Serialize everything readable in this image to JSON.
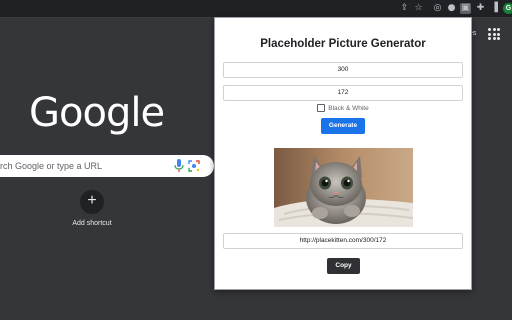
{
  "browser": {
    "icons": [
      "share-icon",
      "star-icon",
      "extension-icon",
      "extension-icon",
      "placeholder-extension-icon",
      "puzzle-icon",
      "sidebar-icon"
    ],
    "profile_initial": "G"
  },
  "ntp": {
    "logo_text": "Google",
    "search_placeholder": "rch Google or type a URL",
    "shortcut_label": "Add shortcut",
    "images_link": "ges"
  },
  "popup": {
    "title": "Placeholder Picture Generator",
    "width_value": "300",
    "height_value": "172",
    "bw_label": "Black & White",
    "bw_checked": false,
    "generate_label": "Generate",
    "url_value": "http://placekitten.com/300/172",
    "copy_label": "Copy"
  },
  "colors": {
    "accent": "#1a73e8",
    "ntp_background": "#35363a",
    "toolbar_background": "#202124"
  }
}
